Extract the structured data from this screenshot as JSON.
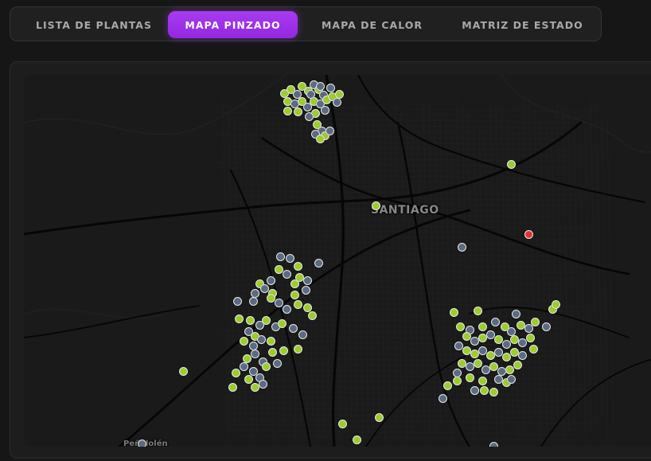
{
  "tabs": [
    {
      "id": "list",
      "label": "LISTA DE PLANTAS",
      "active": false
    },
    {
      "id": "pinmap",
      "label": "MAPA PINZADO",
      "active": true
    },
    {
      "id": "heatmap",
      "label": "MAPA DE CALOR",
      "active": false
    },
    {
      "id": "matrix",
      "label": "MATRIZ DE ESTADO",
      "active": false
    }
  ],
  "map": {
    "city_label": "SANTIAGO",
    "district_label": "Peñalolén",
    "status_colors": {
      "ok": "#9ccc2d",
      "idle": "#5a6b82",
      "alert": "#e03434"
    }
  }
}
